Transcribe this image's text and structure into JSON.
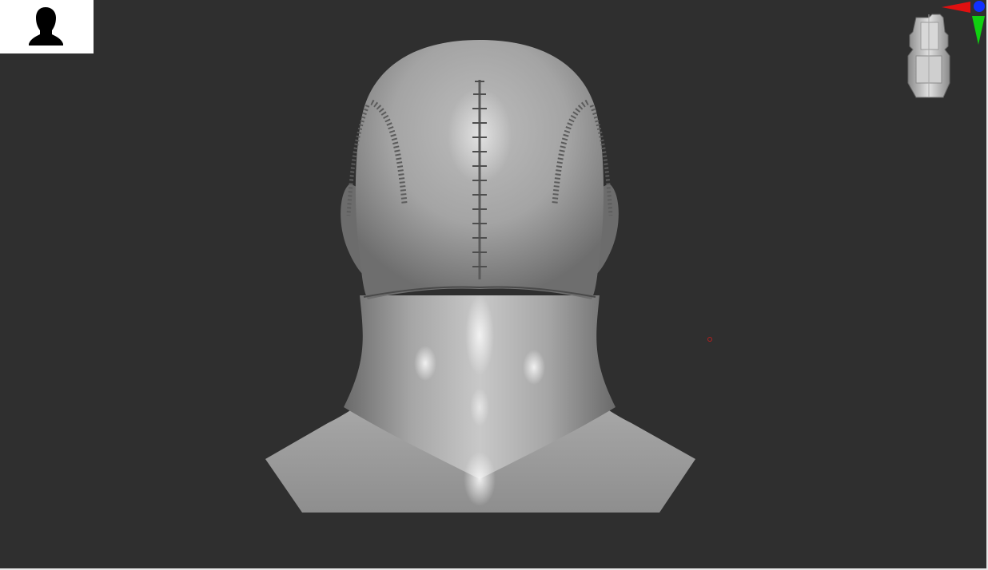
{
  "viewport": {
    "background_color": "#2f2f2f"
  },
  "thumbnail": {
    "icon": "head-silhouette-icon",
    "background_color": "#ffffff",
    "icon_color": "#000000"
  },
  "navigation_gizmo": {
    "icon": "head-orientation-icon",
    "axis_colors": {
      "x": "#e01010",
      "y": "#10d010",
      "z": "#1030ff"
    }
  },
  "model": {
    "icon": "sculpted-head-mesh",
    "base_color": "#9a9a9a"
  },
  "cursor": {
    "icon": "brush-cursor-icon",
    "color": "#b02020"
  }
}
